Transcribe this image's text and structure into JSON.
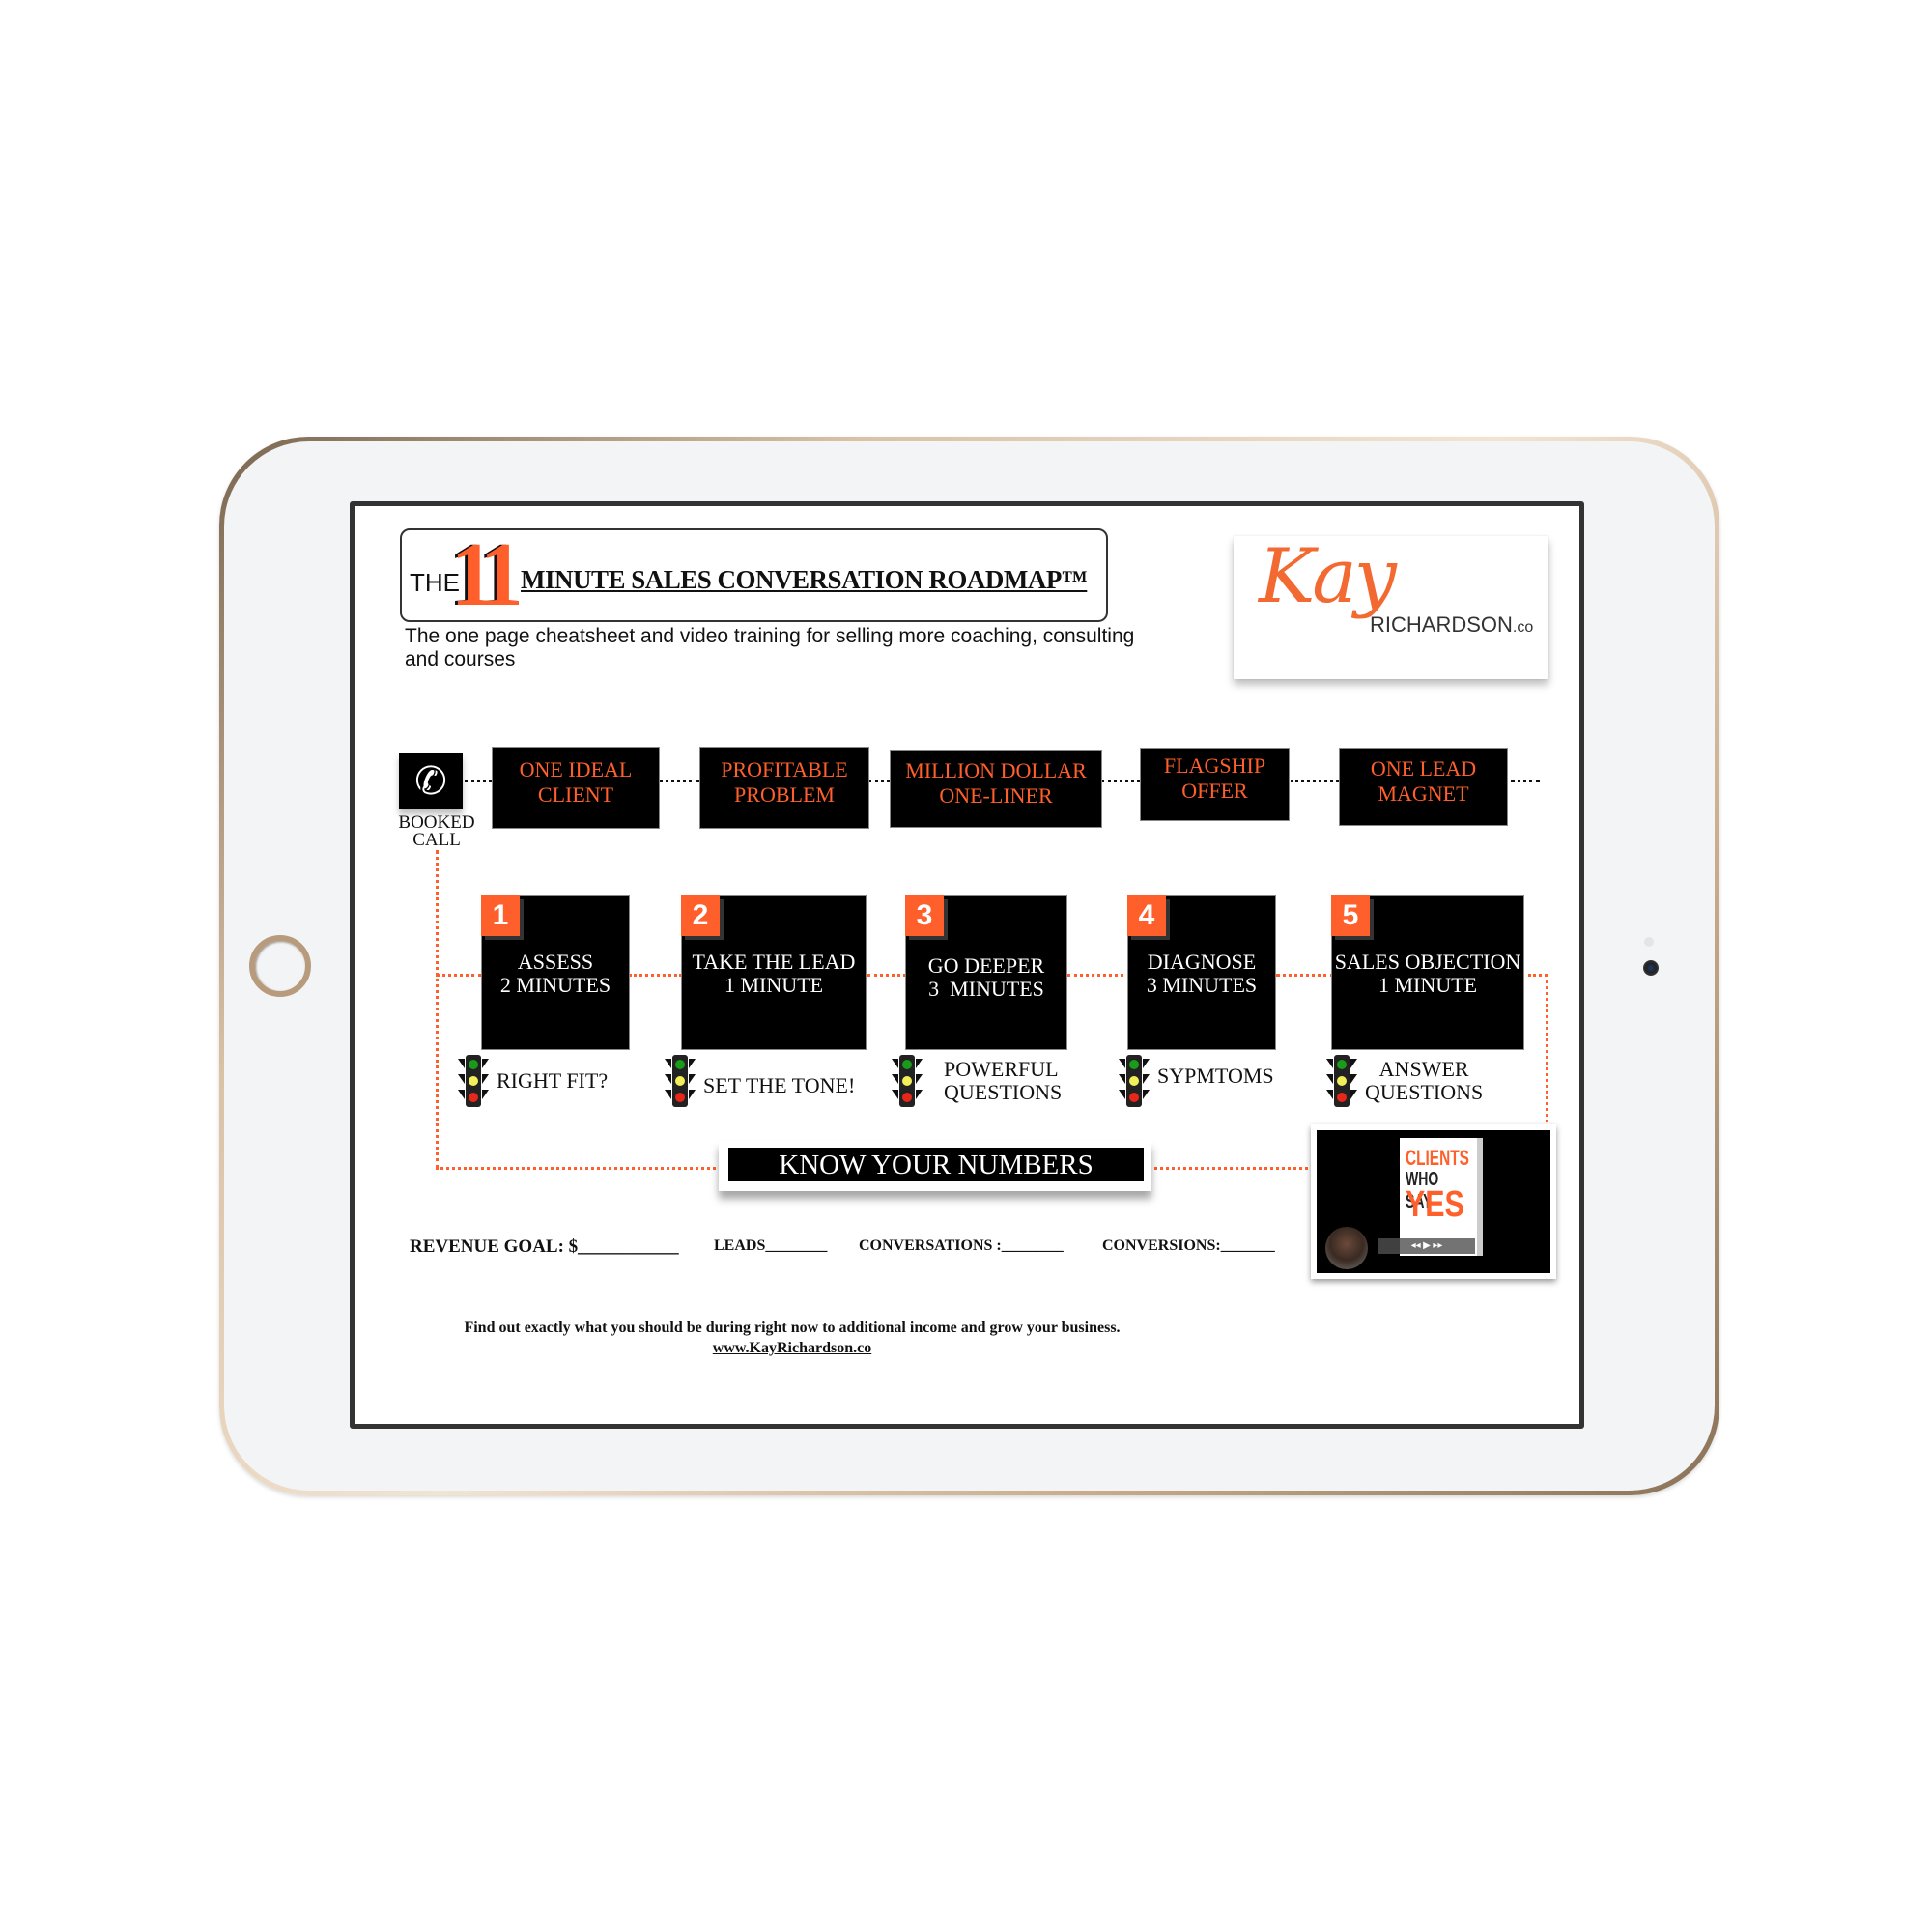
{
  "header": {
    "title_prefix": "THE",
    "title_number": "11",
    "title_main": "MINUTE SALES CONVERSATION ROADMAP™",
    "subtitle": "The one page cheatsheet and video training for selling more coaching, consulting and courses"
  },
  "logo": {
    "script": "Kay",
    "wordmark": "RICHARDSON",
    "suffix": ".co"
  },
  "booked_call": {
    "icon": "phone-icon",
    "label_line1": "BOOKED",
    "label_line2": "CALL"
  },
  "foundations": [
    {
      "line1": "ONE IDEAL",
      "line2": "CLIENT"
    },
    {
      "line1": "PROFITABLE",
      "line2": "PROBLEM"
    },
    {
      "line1": "MILLION DOLLAR",
      "line2": "ONE-LINER"
    },
    {
      "line1": "FLAGSHIP",
      "line2": "OFFER"
    },
    {
      "line1": "ONE LEAD",
      "line2": "MAGNET"
    }
  ],
  "steps": [
    {
      "number": "1",
      "line1": "ASSESS",
      "line2": "2 MINUTES",
      "hint1": "RIGHT FIT?",
      "hint2": ""
    },
    {
      "number": "2",
      "line1": "TAKE THE LEAD",
      "line2": "1 MINUTE",
      "hint1": "SET THE TONE!",
      "hint2": ""
    },
    {
      "number": "3",
      "line1": "GO DEEPER",
      "line2": "3  MINUTES",
      "hint1": "POWERFUL",
      "hint2": "QUESTIONS"
    },
    {
      "number": "4",
      "line1": "DIAGNOSE",
      "line2": "3 MINUTES",
      "hint1": "SYPMTOMS",
      "hint2": ""
    },
    {
      "number": "5",
      "line1": "SALES OBJECTION",
      "line2": "1 MINUTE",
      "hint1": "ANSWER",
      "hint2": "QUESTIONS"
    }
  ],
  "know_your_numbers": "KNOW YOUR NUMBERS",
  "numbers": {
    "revenue_goal": "REVENUE GOAL: $___________",
    "leads": "LEADS________",
    "conversations": "CONVERSATIONS :________",
    "conversions": "CONVERSIONS:_______"
  },
  "video": {
    "book_line1": "CLIENTS",
    "book_line2": "WHO SAY",
    "book_line3": "YES",
    "player_controls": "◂◂  ▶  ▸▸"
  },
  "footer": {
    "text": "Find out exactly what you should be during right now to additional income and grow your business.",
    "link": "www.KayRichardson.co"
  },
  "colors": {
    "accent": "#ff5f2a",
    "box": "#000000",
    "bezel_gold": "#d9c2a6"
  }
}
